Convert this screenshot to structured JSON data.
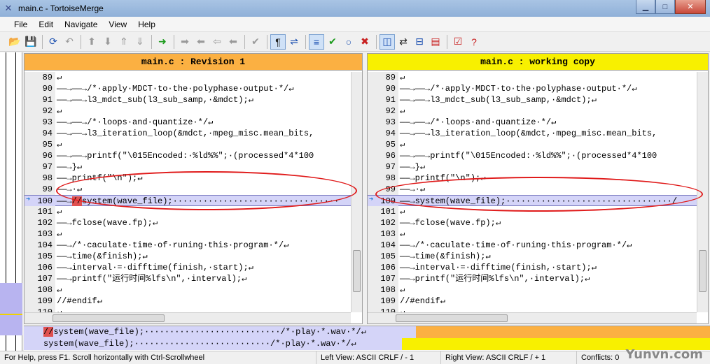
{
  "window": {
    "title": "main.c - TortoiseMerge"
  },
  "menu": [
    "File",
    "Edit",
    "Navigate",
    "View",
    "Help"
  ],
  "left_pane": {
    "title": "main.c : Revision 1",
    "lines": [
      {
        "n": "89",
        "t": "↵"
      },
      {
        "n": "90",
        "t": "——→——→/*·apply·MDCT·to·the·polyphase·output·*/↵"
      },
      {
        "n": "91",
        "t": "——→——→l3_mdct_sub(l3_sub_samp,·&mdct);↵"
      },
      {
        "n": "92",
        "t": "↵"
      },
      {
        "n": "93",
        "t": "——→——→/*·loops·and·quantize·*/↵"
      },
      {
        "n": "94",
        "t": "——→——→l3_iteration_loop(&mdct,·mpeg_misc.mean_bits,"
      },
      {
        "n": "95",
        "t": "↵"
      },
      {
        "n": "96",
        "t": "——→——→printf(\"\\015Encoded:·%ld%%\";·(processed*4*100"
      },
      {
        "n": "97",
        "t": "——→}↵"
      },
      {
        "n": "98",
        "t": "——→printf(\"\\n\");↵"
      },
      {
        "n": "99",
        "t": "——→·↵"
      },
      {
        "n": "100",
        "t": "——→",
        "hl": "//",
        "rest": "system(wave_file);·································"
      },
      {
        "n": "101",
        "t": "↵"
      },
      {
        "n": "102",
        "t": "——→fclose(wave.fp);↵"
      },
      {
        "n": "103",
        "t": "↵"
      },
      {
        "n": "104",
        "t": "——→/*·caculate·time·of·runing·this·program·*/↵"
      },
      {
        "n": "105",
        "t": "——→time(&finish);↵"
      },
      {
        "n": "106",
        "t": "——→interval·=·difftime(finish,·start);↵"
      },
      {
        "n": "107",
        "t": "——→printf(\"运行时间%lfs\\n\",·interval);↵"
      },
      {
        "n": "108",
        "t": "↵"
      },
      {
        "n": "109",
        "t": "//#endif↵"
      },
      {
        "n": "110",
        "t": "↵"
      }
    ]
  },
  "right_pane": {
    "title": "main.c : working copy",
    "lines": [
      {
        "n": "89",
        "t": "↵"
      },
      {
        "n": "90",
        "t": "——→——→/*·apply·MDCT·to·the·polyphase·output·*/↵"
      },
      {
        "n": "91",
        "t": "——→——→l3_mdct_sub(l3_sub_samp,·&mdct);↵"
      },
      {
        "n": "92",
        "t": "↵"
      },
      {
        "n": "93",
        "t": "——→——→/*·loops·and·quantize·*/↵"
      },
      {
        "n": "94",
        "t": "——→——→l3_iteration_loop(&mdct,·mpeg_misc.mean_bits,"
      },
      {
        "n": "95",
        "t": "↵"
      },
      {
        "n": "96",
        "t": "——→——→printf(\"\\015Encoded:·%ld%%\";·(processed*4*100"
      },
      {
        "n": "97",
        "t": "——→}↵"
      },
      {
        "n": "98",
        "t": "——→printf(\"\\n\");↵"
      },
      {
        "n": "99",
        "t": "——→·↵"
      },
      {
        "n": "100",
        "t": "——→system(wave_file);·································/"
      },
      {
        "n": "101",
        "t": "↵"
      },
      {
        "n": "102",
        "t": "——→fclose(wave.fp);↵"
      },
      {
        "n": "103",
        "t": "↵"
      },
      {
        "n": "104",
        "t": "——→/*·caculate·time·of·runing·this·program·*/↵"
      },
      {
        "n": "105",
        "t": "——→time(&finish);↵"
      },
      {
        "n": "106",
        "t": "——→interval·=·difftime(finish,·start);↵"
      },
      {
        "n": "107",
        "t": "——→printf(\"运行时间%lfs\\n\",·interval);↵"
      },
      {
        "n": "108",
        "t": "↵"
      },
      {
        "n": "109",
        "t": "//#endif↵"
      },
      {
        "n": "110",
        "t": "↵"
      }
    ]
  },
  "bottom": {
    "line1_hl": "//",
    "line1_rest": "system(wave_file);···························/*·play·*.wav·*/↵",
    "line2": "system(wave_file);···························/*·play·*.wav·*/↵"
  },
  "status": {
    "help": "For Help, press F1. Scroll horizontally with Ctrl-Scrollwheel",
    "left_view": "Left View: ASCII CRLF  / - 1",
    "right_view": "Right View: ASCII CRLF  / + 1",
    "conflicts": "Conflicts: 0"
  },
  "watermark": "Yunvn.com"
}
